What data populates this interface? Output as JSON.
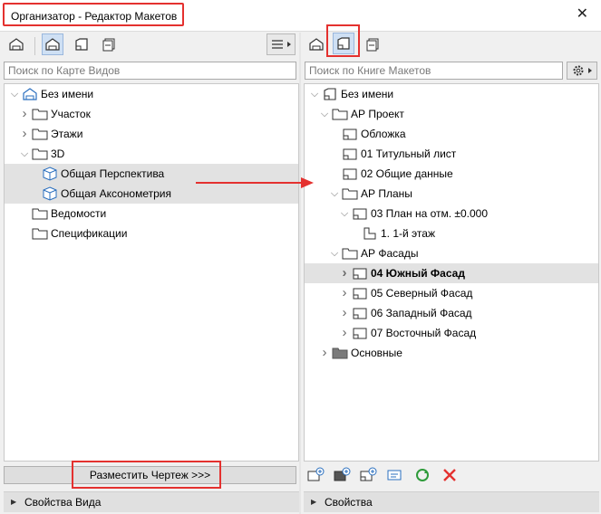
{
  "window": {
    "title": "Организатор - Редактор Макетов",
    "close": "✕"
  },
  "left": {
    "search_placeholder": "Поиск по Карте Видов",
    "tree": [
      {
        "label": "Без имени",
        "arrow": "expanded",
        "icon": "project-root-icon",
        "indent": 0
      },
      {
        "label": "Участок",
        "arrow": "collapsed",
        "icon": "folder-icon",
        "indent": 1
      },
      {
        "label": "Этажи",
        "arrow": "collapsed",
        "icon": "folder-icon",
        "indent": 1
      },
      {
        "label": "3D",
        "arrow": "expanded",
        "icon": "folder-icon",
        "indent": 1
      },
      {
        "label": "Общая Перспектива",
        "arrow": "none",
        "icon": "cube-icon",
        "indent": 2,
        "highlight": true
      },
      {
        "label": "Общая Аксонометрия",
        "arrow": "none",
        "icon": "cube-icon",
        "indent": 2,
        "highlight": true
      },
      {
        "label": "Ведомости",
        "arrow": "none",
        "icon": "folder-icon",
        "indent": 1
      },
      {
        "label": "Спецификации",
        "arrow": "none",
        "icon": "folder-icon",
        "indent": 1
      }
    ],
    "place_button": "Разместить Чертеж >>>",
    "footer": "Свойства Вида"
  },
  "right": {
    "search_placeholder": "Поиск по Книге Макетов",
    "tree": [
      {
        "label": "Без имени",
        "arrow": "expanded",
        "icon": "book-icon",
        "indent": 0
      },
      {
        "label": "АР Проект",
        "arrow": "expanded",
        "icon": "folder-icon",
        "indent": 1
      },
      {
        "label": "Обложка",
        "arrow": "none",
        "icon": "layout-icon",
        "indent": 2
      },
      {
        "label": "01 Титульный лист",
        "arrow": "none",
        "icon": "layout-icon",
        "indent": 2
      },
      {
        "label": "02 Общие данные",
        "arrow": "none",
        "icon": "layout-icon",
        "indent": 2
      },
      {
        "label": "АР Планы",
        "arrow": "expanded",
        "icon": "folder-icon",
        "indent": 2
      },
      {
        "label": "03 План на отм. ±0.000",
        "arrow": "expanded",
        "icon": "layout-icon",
        "indent": 3
      },
      {
        "label": "1. 1-й этаж",
        "arrow": "none",
        "icon": "drawing-icon",
        "indent": 4
      },
      {
        "label": "АР Фасады",
        "arrow": "expanded",
        "icon": "folder-icon",
        "indent": 2
      },
      {
        "label": "04 Южный Фасад",
        "arrow": "collapsed",
        "icon": "layout-icon",
        "indent": 3,
        "highlight": true,
        "bold": true
      },
      {
        "label": "05 Северный Фасад",
        "arrow": "collapsed",
        "icon": "layout-icon",
        "indent": 3
      },
      {
        "label": "06 Западный Фасад",
        "arrow": "collapsed",
        "icon": "layout-icon",
        "indent": 3
      },
      {
        "label": "07 Восточный Фасад",
        "arrow": "collapsed",
        "icon": "layout-icon",
        "indent": 3
      },
      {
        "label": "Основные",
        "arrow": "collapsed",
        "icon": "folder-filled-icon",
        "indent": 1
      }
    ],
    "footer": "Свойства"
  },
  "colors": {
    "highlight_box": "#e4312f",
    "arrow": "#e4312f",
    "selected_tool": "#cfe0f4",
    "row_highlight": "#e2e2e2"
  }
}
